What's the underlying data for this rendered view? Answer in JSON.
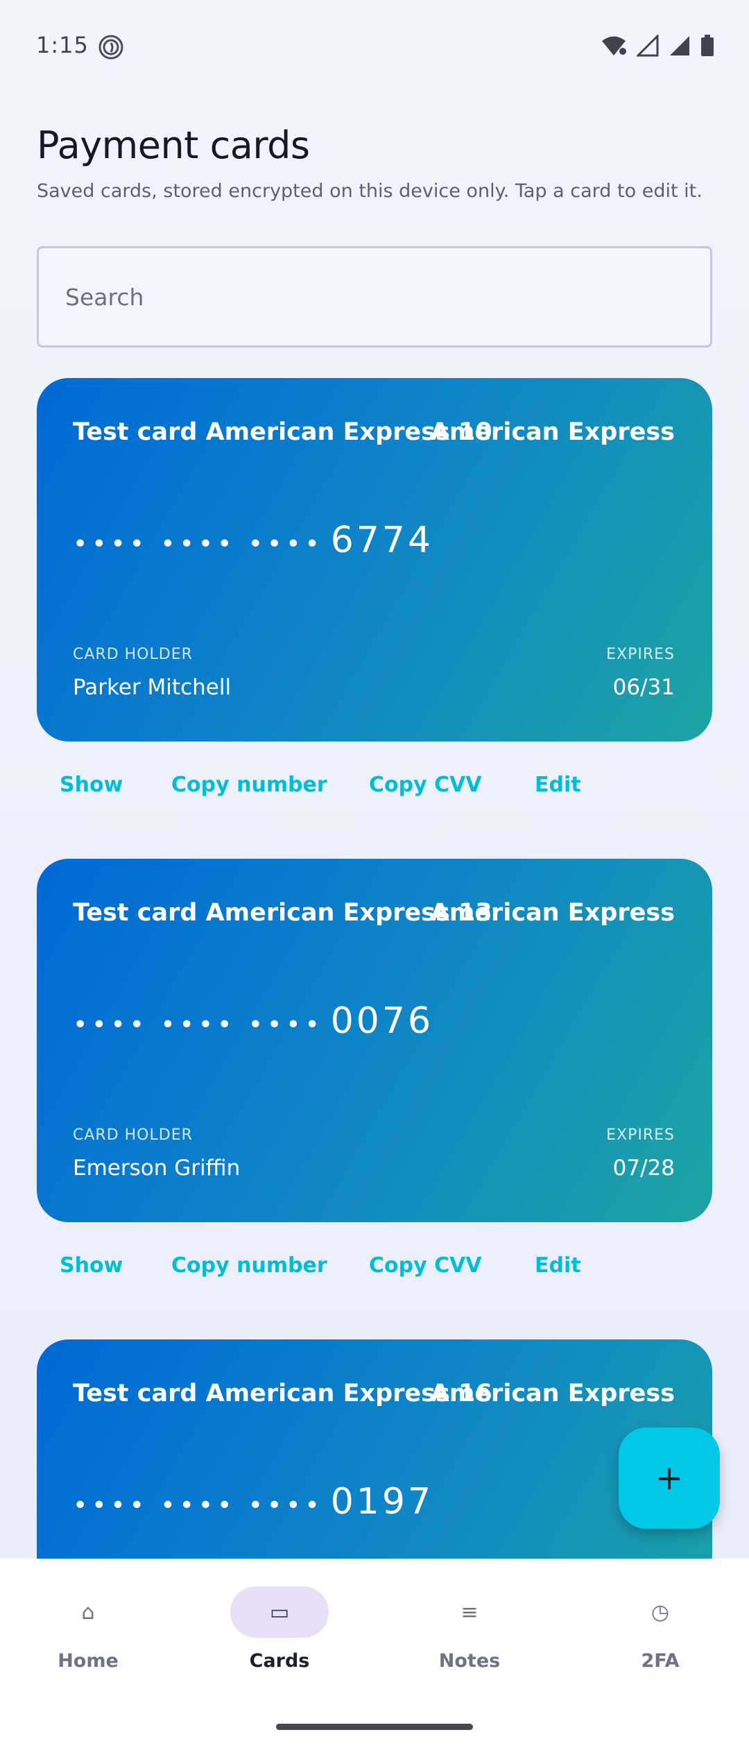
{
  "status_bar": {
    "time": "1:15",
    "icons": [
      "fingerprint-icon",
      "wifi-icon",
      "signal-icon",
      "signal-full-icon",
      "battery-icon"
    ]
  },
  "header": {
    "title": "Payment cards",
    "subtitle": "Saved cards, stored encrypted on this device only. Tap a card to edit it."
  },
  "search": {
    "placeholder": "Search",
    "value": ""
  },
  "colors": {
    "card_gradient_start": "#0069d6",
    "card_gradient_end": "#1ea4a3",
    "accent": "#00bcd8",
    "fab": "#00c8e6",
    "nav_active_pill": "#e7dff5"
  },
  "cards": [
    {
      "name": "Test card American Express 10",
      "brand": "American Express",
      "masked": "•••• •••• ••••",
      "last4": "6774",
      "holder_label": "CARD HOLDER",
      "holder": "Parker Mitchell",
      "expires_label": "EXPIRES",
      "expires": "06/31"
    },
    {
      "name": "Test card American Express 13",
      "brand": "American Express",
      "masked": "•••• •••• ••••",
      "last4": "0076",
      "holder_label": "CARD HOLDER",
      "holder": "Emerson Griffin",
      "expires_label": "EXPIRES",
      "expires": "07/28"
    },
    {
      "name": "Test card American Express 16",
      "brand": "American Express",
      "masked": "•••• •••• ••••",
      "last4": "0197"
    }
  ],
  "card_actions": {
    "show": "Show",
    "copy_number": "Copy number",
    "copy_cvv": "Copy CVV",
    "edit": "Edit"
  },
  "fab": {
    "label": "+",
    "icon": "add-icon"
  },
  "nav": [
    {
      "label": "Home",
      "icon": "⌂",
      "icon_name": "home-icon"
    },
    {
      "label": "Cards",
      "icon": "▭",
      "icon_name": "card-icon",
      "active": true
    },
    {
      "label": "Notes",
      "icon": "≡",
      "icon_name": "notes-icon"
    },
    {
      "label": "2FA",
      "icon": "◷",
      "icon_name": "clock-icon"
    }
  ]
}
